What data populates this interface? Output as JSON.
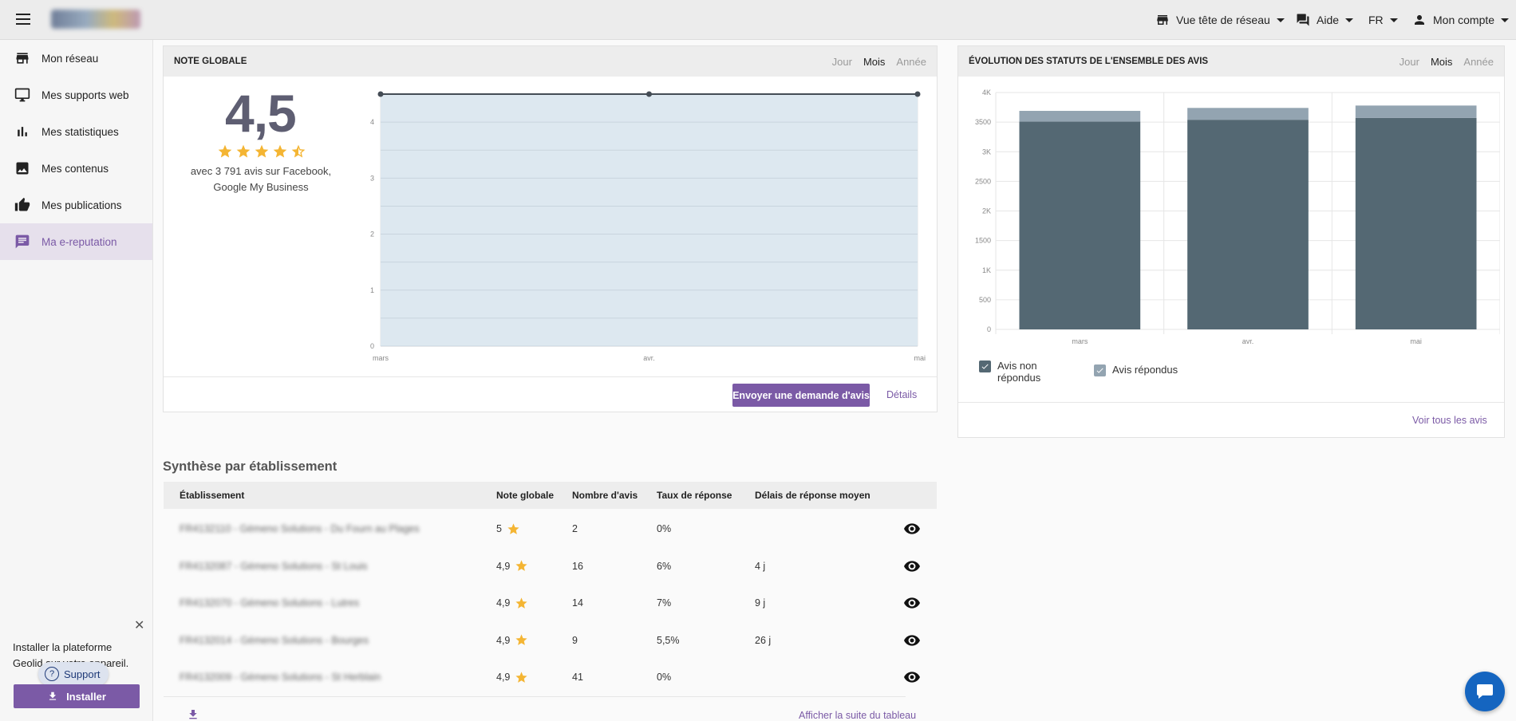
{
  "topbar": {
    "items": [
      {
        "label": "Vue tête de réseau"
      },
      {
        "label": "Aide"
      },
      {
        "label": "FR"
      },
      {
        "label": "Mon compte"
      }
    ]
  },
  "sidebar": {
    "items": [
      {
        "label": "Mon réseau",
        "icon": "store-icon"
      },
      {
        "label": "Mes supports web",
        "icon": "monitor-icon"
      },
      {
        "label": "Mes statistiques",
        "icon": "bar-chart-icon"
      },
      {
        "label": "Mes contenus",
        "icon": "image-icon"
      },
      {
        "label": "Mes publications",
        "icon": "thumbs-up-icon"
      },
      {
        "label": "Ma e-reputation",
        "icon": "chat-icon",
        "active": true
      }
    ],
    "install": {
      "text": "Installer la plateforme Geolid sur votre appareil.",
      "button": "Installer"
    },
    "support": "Support"
  },
  "note_card": {
    "title": "NOTE GLOBALE",
    "periods": [
      "Jour",
      "Mois",
      "Année"
    ],
    "selected_period": "Mois",
    "score": "4,5",
    "subtitle": "avec 3 791 avis sur Facebook, Google My Business",
    "send_button": "Envoyer une demande d'avis",
    "details_link": "Détails"
  },
  "status_card": {
    "title": "ÉVOLUTION DES STATUTS DE L'ENSEMBLE DES AVIS",
    "periods": [
      "Jour",
      "Mois",
      "Année"
    ],
    "selected_period": "Mois",
    "legend": [
      {
        "label": "Avis non répondus",
        "color": "#546873"
      },
      {
        "label": "Avis répondus",
        "color": "#93a4b1"
      }
    ],
    "see_all": "Voir tous les avis"
  },
  "chart_data": [
    {
      "type": "area",
      "categories": [
        "mars",
        "avr.",
        "mai"
      ],
      "values": [
        4.5,
        4.5,
        4.5
      ],
      "ylim": [
        0,
        4.5
      ],
      "yticks": [
        0,
        1,
        2,
        3,
        4
      ],
      "grid": true,
      "colors": {
        "fill": "#dde8f0",
        "line": "#444c55"
      }
    },
    {
      "type": "bar",
      "stacked": true,
      "categories": [
        "mars",
        "avr.",
        "mai"
      ],
      "series": [
        {
          "name": "Avis non répondus",
          "values": [
            3510,
            3540,
            3570
          ],
          "color": "#546873"
        },
        {
          "name": "Avis répondus",
          "values": [
            180,
            200,
            210
          ],
          "color": "#93a4b1"
        }
      ],
      "ylim": [
        0,
        4000
      ],
      "yticks": [
        "0",
        "500",
        "1K",
        "1500",
        "2K",
        "2500",
        "3K",
        "3500",
        "4K"
      ],
      "grid": true
    }
  ],
  "synthese": {
    "title": "Synthèse par établissement",
    "columns": [
      "Établissement",
      "Note globale",
      "Nombre d'avis",
      "Taux de réponse",
      "Délais de réponse moyen"
    ],
    "rows": [
      {
        "name": "FR4132110 - Gémeno Solutions - Du Fourn au Plages",
        "note": "5",
        "avis": "2",
        "taux": "0%",
        "delai": ""
      },
      {
        "name": "FR4132087 - Gémeno Solutions - St Louis",
        "note": "4,9",
        "avis": "16",
        "taux": "6%",
        "delai": "4 j"
      },
      {
        "name": "FR4132070 - Gémeno Solutions - Lutres",
        "note": "4,9",
        "avis": "14",
        "taux": "7%",
        "delai": "9 j"
      },
      {
        "name": "FR4132014 - Gémeno Solutions - Bourges",
        "note": "4,9",
        "avis": "9",
        "taux": "5,5%",
        "delai": "26 j"
      },
      {
        "name": "FR4132009 - Gémeno Solutions - St Herblain",
        "note": "4,9",
        "avis": "41",
        "taux": "0%",
        "delai": ""
      }
    ],
    "more_link": "Afficher la suite du tableau"
  },
  "colors": {
    "accent": "#7b5aa6",
    "star": "#f4b533",
    "chat_fab": "#1565c0"
  }
}
